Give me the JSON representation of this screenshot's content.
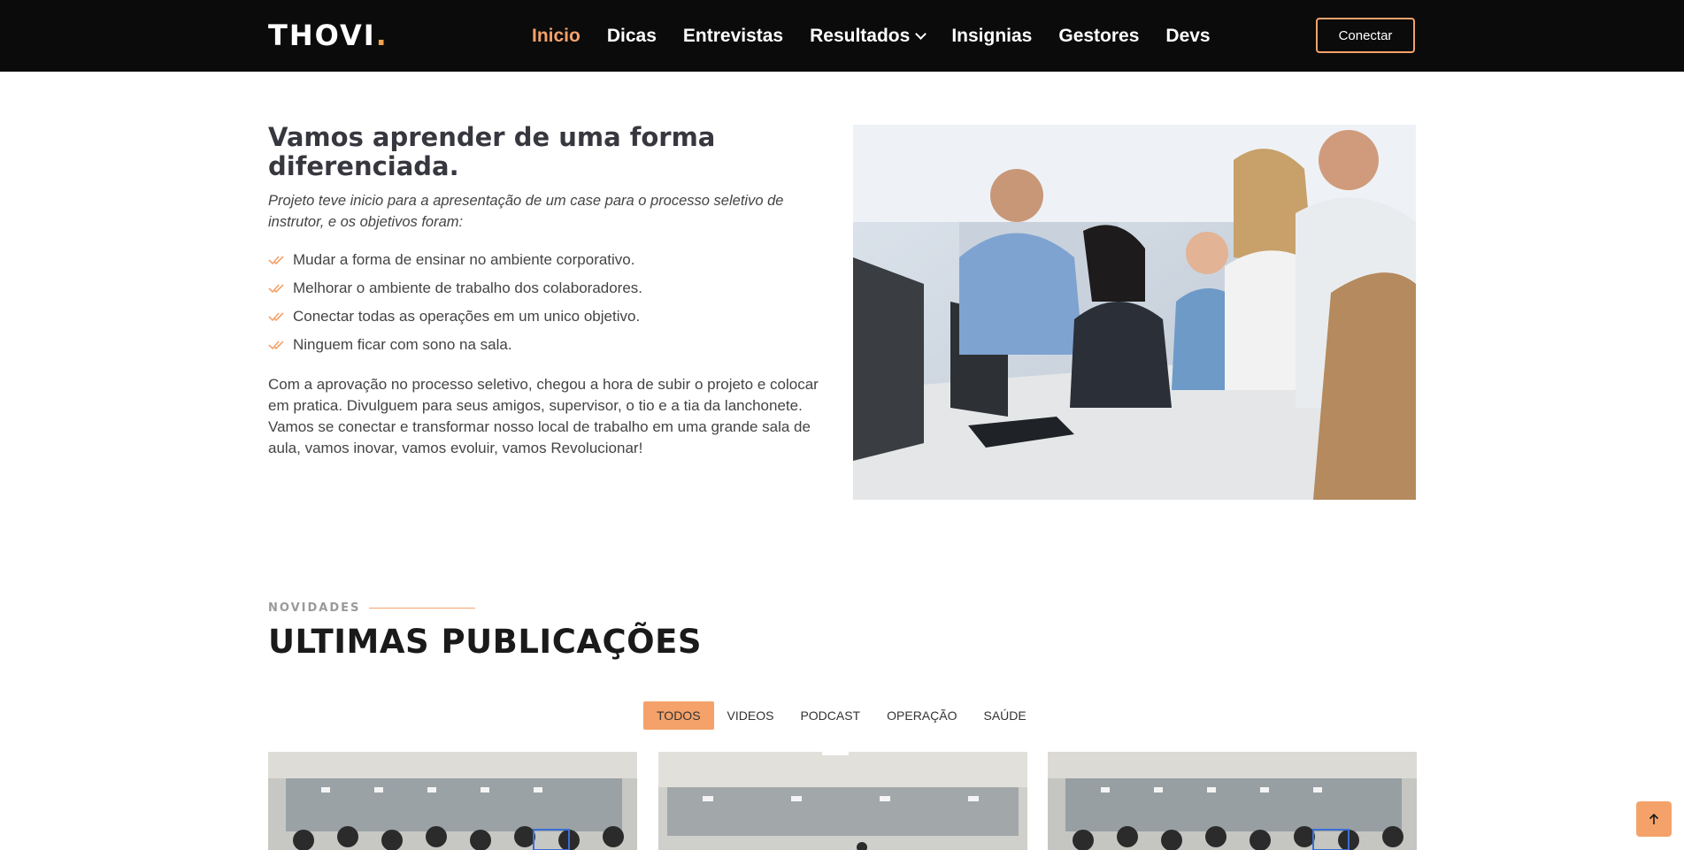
{
  "header": {
    "logo": "THOVI",
    "logo_dot": ".",
    "nav": [
      {
        "label": "Inicio",
        "active": true
      },
      {
        "label": "Dicas"
      },
      {
        "label": "Entrevistas"
      },
      {
        "label": "Resultados",
        "dropdown": true
      },
      {
        "label": "Insignias"
      },
      {
        "label": "Gestores"
      },
      {
        "label": "Devs"
      }
    ],
    "connect_label": "Conectar"
  },
  "about": {
    "title": "Vamos aprender de uma forma diferenciada.",
    "intro": "Projeto teve inicio para a apresentação de um case para o processo seletivo de instrutor, e os objetivos foram:",
    "objectives": [
      "Mudar a forma de ensinar no ambiente corporativo.",
      "Melhorar o ambiente de trabalho dos colaboradores.",
      "Conectar todas as operações em um unico objetivo.",
      "Ninguem ficar com sono na sala."
    ],
    "body": "Com a aprovação no processo seletivo, chegou a hora de subir o projeto e colocar em pratica. Divulguem para seus amigos, supervisor, o tio e a tia da lanchonete. Vamos se conectar e transformar nosso local de trabalho em uma grande sala de aula, vamos inovar, vamos evoluir, vamos Revolucionar!"
  },
  "publications": {
    "kicker": "NOVIDADES",
    "title": "ULTIMAS PUBLICAÇÕES",
    "filters": [
      {
        "label": "TODOS",
        "active": true
      },
      {
        "label": "VIDEOS"
      },
      {
        "label": "PODCAST"
      },
      {
        "label": "OPERAÇÃO"
      },
      {
        "label": "SAÚDE"
      }
    ]
  },
  "colors": {
    "accent": "#f4a26a",
    "header_bg": "#0b0b0b",
    "title": "#37373f"
  },
  "icons": {
    "check": "double-check-icon",
    "back_to_top": "arrow-up-icon"
  }
}
